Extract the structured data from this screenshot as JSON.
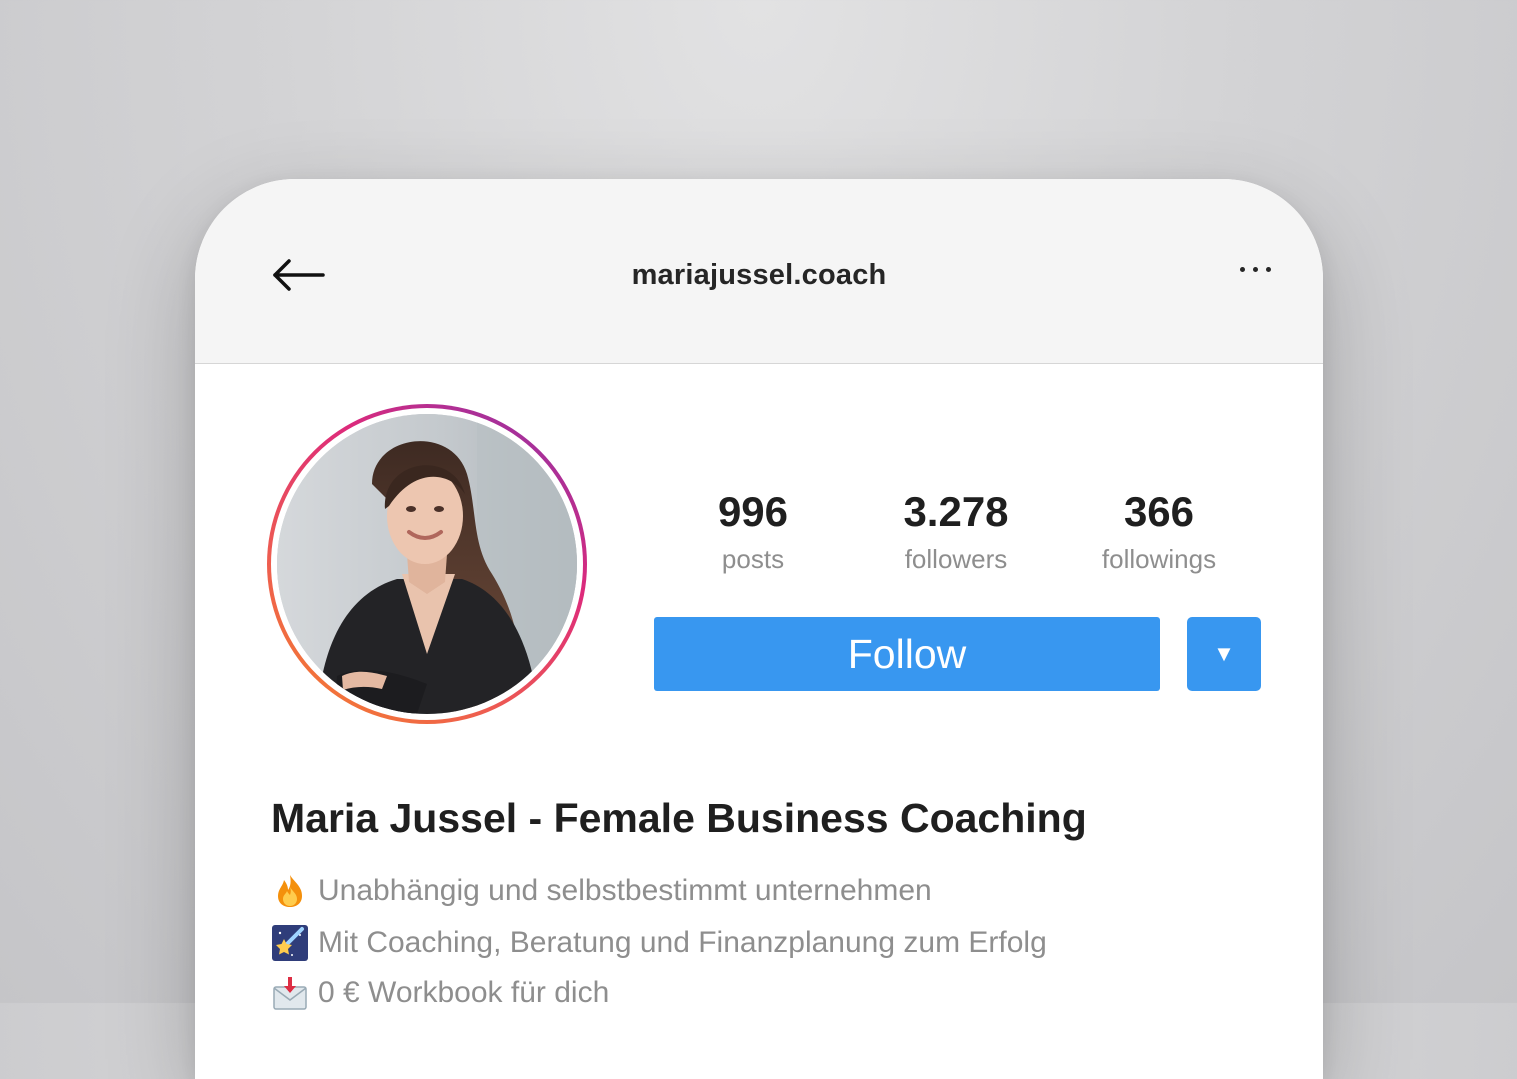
{
  "header": {
    "username": "mariajussel.coach",
    "back_icon": "arrow-left-icon",
    "more_icon": "more-horizontal-icon"
  },
  "profile": {
    "avatar_description": "profile-photo",
    "stats": [
      {
        "value": "996",
        "label": "posts"
      },
      {
        "value": "3.278",
        "label": "followers"
      },
      {
        "value": "366",
        "label": "followings"
      }
    ],
    "follow_label": "Follow",
    "dropdown_glyph": "▼",
    "display_name": "Maria Jussel - Female Business Coaching",
    "bio": [
      {
        "icon": "fire-emoji-icon",
        "text": "Unabhängig und selbstbestimmt unternehmen"
      },
      {
        "icon": "shooting-star-emoji-icon",
        "text": "Mit Coaching, Beratung und Finanzplanung zum Erfolg"
      },
      {
        "icon": "incoming-envelope-emoji-icon",
        "text": "0 € Workbook für dich"
      }
    ]
  },
  "colors": {
    "accent": "#3897f0",
    "ring_start": "#f58529",
    "ring_end": "#8134af",
    "text_primary": "#1f1f1f",
    "text_secondary": "#8e8e8e"
  }
}
